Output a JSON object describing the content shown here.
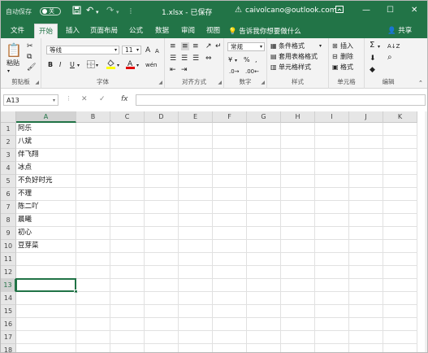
{
  "titlebar": {
    "autosave_label": "自动保存",
    "autosave_state": "关",
    "save_icon": "save-icon",
    "undo_icon": "undo-icon",
    "redo_icon": "redo-icon",
    "title": "1.xlsx - 已保存",
    "user_email": "caivolcano@outlook.com",
    "warning_icon": "warning-icon",
    "minimize": "—",
    "restore": "☐",
    "close": "✕"
  },
  "tabs": [
    "文件",
    "开始",
    "插入",
    "页面布局",
    "公式",
    "数据",
    "审阅",
    "视图"
  ],
  "active_tab": "开始",
  "tellme": "告诉我你想要做什么",
  "share": "共享",
  "ribbon": {
    "clipboard": {
      "label": "剪贴板",
      "paste": "粘贴"
    },
    "font": {
      "label": "字体",
      "font_name": "等线",
      "font_size": "11",
      "bold": "B",
      "italic": "I",
      "underline": "U",
      "grow": "A",
      "shrink": "A",
      "phonetic": "wén"
    },
    "alignment": {
      "label": "对齐方式"
    },
    "number": {
      "label": "数字",
      "format": "常规",
      "currency": "¥",
      "percent": "%",
      "comma": ","
    },
    "styles": {
      "label": "样式",
      "conditional": "条件格式",
      "table": "套用表格格式",
      "cell_styles": "单元格样式"
    },
    "cells": {
      "label": "单元格",
      "insert": "插入",
      "delete": "删除",
      "format": "格式"
    },
    "editing": {
      "label": "编辑",
      "sum": "Σ",
      "sort": "A↓Z",
      "find": "⌕"
    }
  },
  "formula_bar": {
    "name_box": "A13",
    "cancel": "✕",
    "enter": "✓",
    "fx": "fx",
    "value": ""
  },
  "colors": {
    "brand": "#227447",
    "ribbon_bg": "#f3f3f3",
    "grid": "#e1e1e1"
  },
  "sheet": {
    "columns": [
      "A",
      "B",
      "C",
      "D",
      "E",
      "F",
      "G",
      "H",
      "I",
      "J",
      "K"
    ],
    "selected_column": "A",
    "rows": [
      {
        "n": "1",
        "a": "阿乐"
      },
      {
        "n": "2",
        "a": "八斌"
      },
      {
        "n": "3",
        "a": "伴飞翔"
      },
      {
        "n": "4",
        "a": "冰点"
      },
      {
        "n": "5",
        "a": "不负好时光"
      },
      {
        "n": "6",
        "a": "不理"
      },
      {
        "n": "7",
        "a": "陈二吖"
      },
      {
        "n": "8",
        "a": "晨曦"
      },
      {
        "n": "9",
        "a": "初心"
      },
      {
        "n": "10",
        "a": "豆芽菜"
      },
      {
        "n": "11",
        "a": ""
      },
      {
        "n": "12",
        "a": ""
      },
      {
        "n": "13",
        "a": ""
      },
      {
        "n": "14",
        "a": ""
      },
      {
        "n": "15",
        "a": ""
      },
      {
        "n": "16",
        "a": ""
      },
      {
        "n": "17",
        "a": ""
      },
      {
        "n": "18",
        "a": ""
      }
    ],
    "active_row": "13"
  }
}
